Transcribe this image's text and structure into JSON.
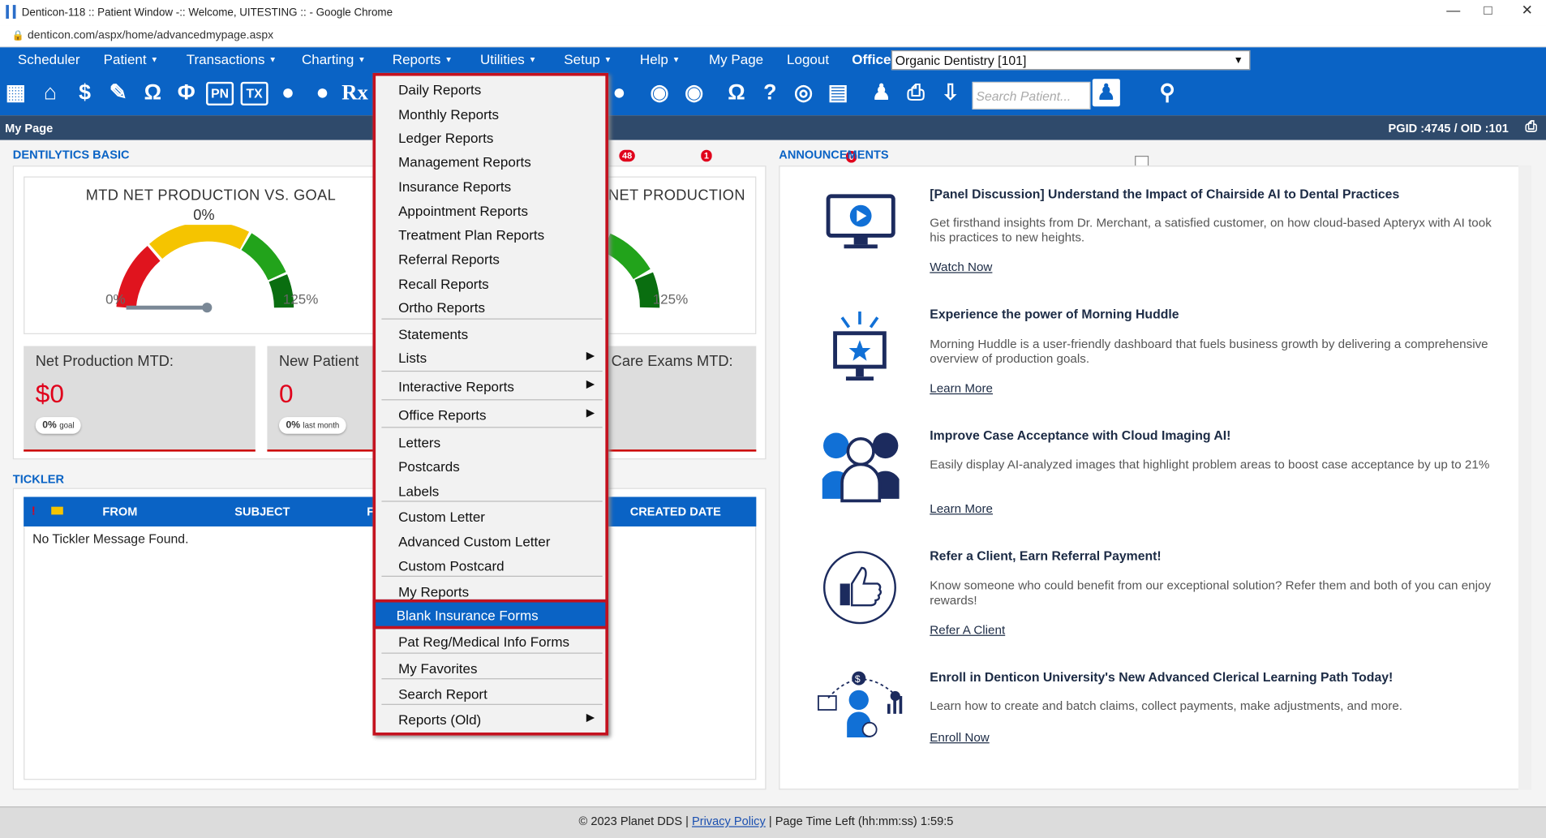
{
  "window": {
    "title": "Denticon-118 :: Patient Window -:: Welcome, UITESTING :: - Google Chrome",
    "url": "denticon.com/aspx/home/advancedmypage.aspx"
  },
  "menubar": {
    "items": [
      "Scheduler",
      "Patient",
      "Transactions",
      "Charting",
      "Reports",
      "Utilities",
      "Setup",
      "Help",
      "My Page",
      "Logout"
    ],
    "office_label": "Office",
    "office_value": "Organic Dentistry [101]"
  },
  "iconbar": {
    "search_placeholder": "Search Patient...",
    "badge_a": "48",
    "badge_b": "1",
    "badge_c": "0",
    "pn": "PN",
    "tx": "TX",
    "rx": "Rx"
  },
  "subbar": {
    "title": "My Page",
    "ids": "PGID :4745  /  OID :101"
  },
  "dentilytics": {
    "heading": "DENTILYTICS BASIC",
    "gauge1_title": "MTD NET PRODUCTION VS. GOAL",
    "gauge1_pct": "0%",
    "gauge_min": "0%",
    "gauge_max": "125%",
    "gauge2_title": "NET PRODUCTION",
    "gauge2_max": "125%",
    "tile1": {
      "label": "Net Production MTD:",
      "value": "$0",
      "pill": "0%",
      "pill_sub": "goal"
    },
    "tile2": {
      "label": "New Patient",
      "value": "0",
      "pill": "0%",
      "pill_sub": "last month"
    },
    "tile3": {
      "label": "Care Exams MTD:"
    }
  },
  "tickler": {
    "heading": "TICKLER",
    "cols": [
      "FROM",
      "SUBJECT",
      "F",
      "CREATED DATE"
    ],
    "empty": "No Tickler Message Found."
  },
  "announcements": {
    "heading": "ANNOUNCEMENTS",
    "items": [
      {
        "title": "[Panel Discussion] Understand the Impact of Chairside AI to Dental Practices",
        "desc": "Get firsthand insights from Dr. Merchant, a satisfied customer, on how cloud-based Apteryx with AI took his practices to new heights.",
        "link": "Watch Now"
      },
      {
        "title": "Experience the power of Morning Huddle",
        "desc": "Morning Huddle is a user-friendly dashboard that fuels business growth by delivering a comprehensive overview of production goals.",
        "link": "Learn More"
      },
      {
        "title": "Improve Case Acceptance with Cloud Imaging AI!",
        "desc": "Easily display AI-analyzed images that highlight problem areas to boost case acceptance by up to 21%",
        "link": "Learn More"
      },
      {
        "title": "Refer a Client, Earn Referral Payment!",
        "desc": "Know someone who could benefit from our exceptional solution? Refer them and both of you can enjoy rewards!",
        "link": "Refer A Client"
      },
      {
        "title": "Enroll in Denticon University's New Advanced Clerical Learning Path Today!",
        "desc": "Learn how to create and batch claims, collect payments, make adjustments, and more.",
        "link": "Enroll Now"
      }
    ]
  },
  "reports_menu": {
    "items": [
      "Daily Reports",
      "Monthly Reports",
      "Ledger Reports",
      "Management Reports",
      "Insurance Reports",
      "Appointment Reports",
      "Treatment Plan Reports",
      "Referral Reports",
      "Recall Reports",
      "Ortho Reports",
      "Statements",
      "Lists",
      "Interactive Reports",
      "Office Reports",
      "Letters",
      "Postcards",
      "Labels",
      "Custom Letter",
      "Advanced Custom Letter",
      "Custom Postcard",
      "My Reports",
      "Blank Insurance Forms",
      "Pat Reg/Medical Info Forms",
      "My Favorites",
      "Search Report",
      "Reports (Old)"
    ]
  },
  "footer": {
    "copy": "© 2023 Planet DDS",
    "link": "Privacy Policy",
    "sep": "|",
    "time": "Page Time Left (hh:mm:ss) 1:59:5"
  }
}
